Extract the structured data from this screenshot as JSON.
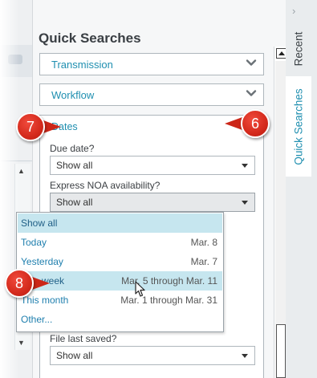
{
  "panel": {
    "title": "Quick Searches",
    "sections": [
      {
        "label": "Transmission"
      },
      {
        "label": "Workflow"
      }
    ],
    "dates": {
      "header": "Dates",
      "due_date": {
        "label": "Due date?",
        "value": "Show all"
      },
      "express_noa": {
        "label": "Express NOA availability?",
        "value": "Show all"
      },
      "file_last_saved": {
        "label": "File last saved?",
        "value": "Show all"
      }
    }
  },
  "dropdown": {
    "items": [
      {
        "label": "Show all",
        "detail": ""
      },
      {
        "label": "Today",
        "detail": "Mar. 8"
      },
      {
        "label": "Yesterday",
        "detail": "Mar. 7"
      },
      {
        "label": "This week",
        "detail": "Mar. 5 through Mar. 11"
      },
      {
        "label": "This month",
        "detail": "Mar. 1 through Mar. 31"
      },
      {
        "label": "Other...",
        "detail": ""
      }
    ],
    "selected_index": 0,
    "hovered_index": 3
  },
  "tabs": {
    "recent": "Recent",
    "quick_searches": "Quick Searches",
    "collapse_glyph": "›"
  },
  "callouts": {
    "c6": "6",
    "c7": "7",
    "c8": "8"
  },
  "colors": {
    "accent": "#1f8fb0",
    "highlight": "#c6e6ef",
    "callout_red": "#d42a1c"
  },
  "icons": {
    "chevron": "chevron-down-icon",
    "select_arrow": "triangle-down-icon",
    "scroll_up": "arrow-up-icon",
    "cursor": "mouse-pointer-icon"
  }
}
